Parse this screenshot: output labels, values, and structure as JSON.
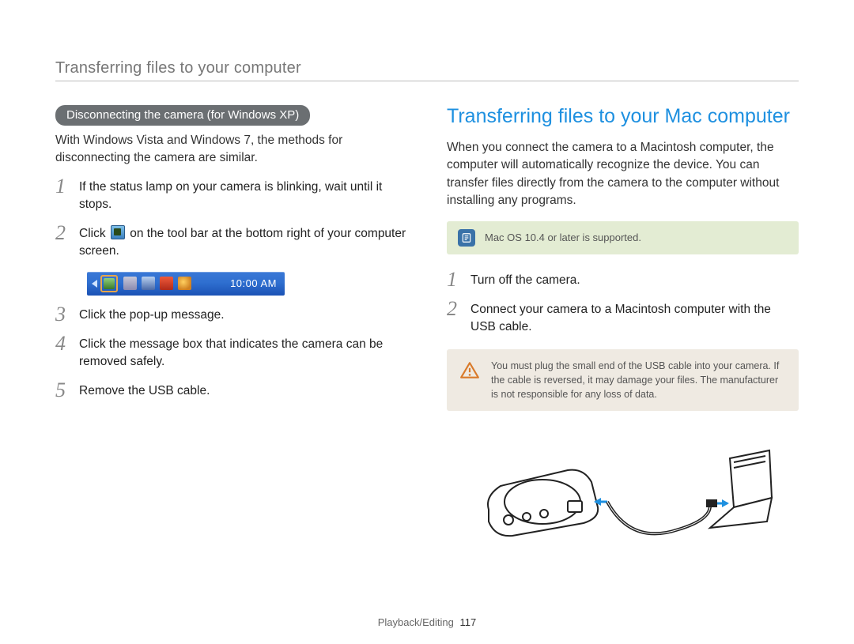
{
  "header": {
    "breadcrumb": "Transferring files to your computer"
  },
  "left": {
    "pill": "Disconnecting the camera (for Windows XP)",
    "intro": "With Windows Vista and Windows 7, the methods for disconnecting the camera are similar.",
    "steps": [
      {
        "num": "1",
        "text": "If the status lamp on your camera is blinking, wait until it stops."
      },
      {
        "num": "2",
        "text_pre": "Click ",
        "text_post": " on the tool bar at the bottom right of your computer screen."
      },
      {
        "num": "3",
        "text": "Click the pop-up message."
      },
      {
        "num": "4",
        "text": "Click the message box that indicates the camera can be removed safely."
      },
      {
        "num": "5",
        "text": "Remove the USB cable."
      }
    ],
    "tray_time": "10:00 AM"
  },
  "right": {
    "title": "Transferring files to your Mac computer",
    "intro": "When you connect the camera to a Macintosh computer, the computer will automatically recognize the device. You can transfer files directly from the camera to the computer without installing any programs.",
    "note": "Mac OS 10.4 or later is supported.",
    "steps": [
      {
        "num": "1",
        "text": "Turn off the camera."
      },
      {
        "num": "2",
        "text": "Connect your camera to a Macintosh computer with the USB cable."
      }
    ],
    "warning": "You must plug the small end of the USB cable into your camera. If the cable is reversed, it may damage your files. The manufacturer is not responsible for any loss of data."
  },
  "footer": {
    "section": "Playback/Editing",
    "page": "117"
  }
}
